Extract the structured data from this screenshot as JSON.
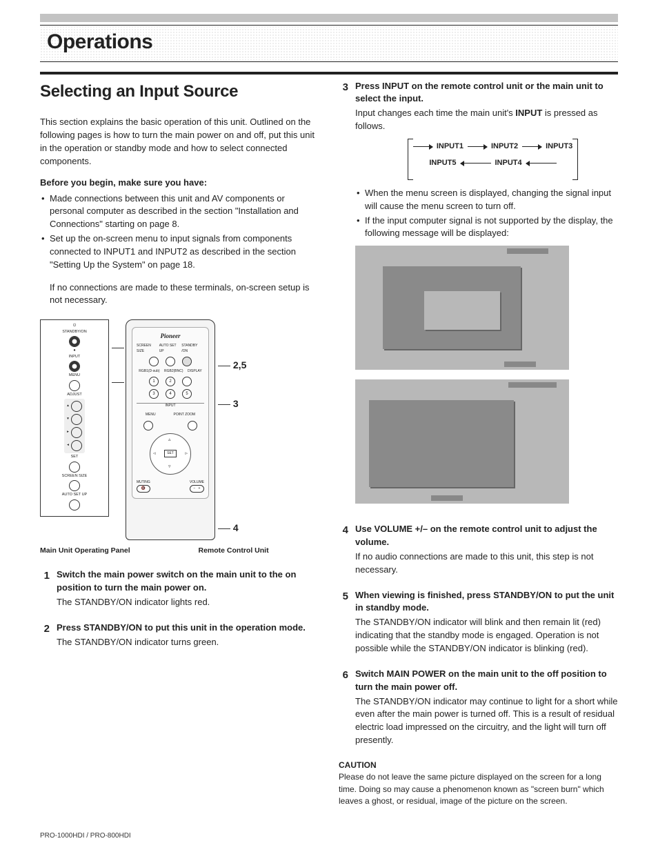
{
  "chapter": "Operations",
  "section_title": "Selecting an Input Source",
  "intro": "This section explains the basic operation of this unit. Outlined on the following pages is how to turn the main power on and off, put this unit in the operation or standby mode and how to select connected components.",
  "before_begin_heading": "Before you begin, make sure you have:",
  "before_begin_items": [
    "Made connections between this unit and AV components or personal computer as described in the section \"Installation and Connections\" starting on page 8.",
    "Set up the on-screen menu to input signals from components connected to INPUT1 and INPUT2 as described in the section \"Setting Up the System\" on page 18."
  ],
  "before_begin_note": "If no connections are made to these terminals, on-screen setup is not necessary.",
  "panel_caption": "Main Unit Operating Panel",
  "remote_caption": "Remote Control Unit",
  "panel_labels": {
    "standby": "STANDBY/ON",
    "input": "INPUT",
    "menu": "MENU",
    "adjust": "ADJUST",
    "set": "SET",
    "screen_size": "SCREEN SIZE",
    "auto_setup": "AUTO SET UP"
  },
  "remote_labels": {
    "brand": "Pioneer",
    "screen_size": "SCREEN SIZE",
    "auto_setup": "AUTO SET UP",
    "standby": "STANDBY /ON",
    "rgb1": "RGB1(D-sub)",
    "rgb2": "RGB2(BNC)",
    "display": "DISPLAY",
    "input_hdr": "INPUT",
    "menu": "MENU",
    "point_zoom": "POINT ZOOM",
    "set": "SET",
    "muting": "MUTING",
    "volume": "VOLUME"
  },
  "callouts": {
    "panel_25": "2,5",
    "panel_3": "3",
    "remote_25": "2,5",
    "remote_3": "3",
    "remote_4": "4"
  },
  "steps_left": [
    {
      "num": "1",
      "head": "Switch the main power switch on the main unit to the on position to turn the main power on.",
      "body": [
        "The STANDBY/ON indicator lights red."
      ]
    },
    {
      "num": "2",
      "head": "Press STANDBY/ON to put this unit in the operation mode.",
      "body": [
        "The STANDBY/ON indicator turns green."
      ]
    }
  ],
  "step3": {
    "num": "3",
    "head": "Press INPUT on the remote control unit or the main unit to select the input.",
    "body1": "Input changes each time the main unit's ",
    "body1_bold": "INPUT",
    "body1_tail": " is pressed as follows.",
    "cycle": {
      "i1": "INPUT1",
      "i2": "INPUT2",
      "i3": "INPUT3",
      "i4": "INPUT4",
      "i5": "INPUT5"
    },
    "bullets": [
      "When the menu screen is displayed, changing the signal input will cause the menu screen to turn off.",
      "If the input computer signal is not supported by the display, the following message will be displayed:"
    ]
  },
  "step4": {
    "num": "4",
    "head": "Use VOLUME +/– on the remote control unit to adjust the volume.",
    "body": [
      "If no audio connections are made to this unit, this step is not necessary."
    ]
  },
  "step5": {
    "num": "5",
    "head": "When viewing is finished, press STANDBY/ON to put the unit in standby mode.",
    "body": [
      "The STANDBY/ON indicator will blink and then remain lit (red) indicating that the standby mode is engaged. Operation is not possible while the STANDBY/ON indicator is blinking (red)."
    ]
  },
  "step6": {
    "num": "6",
    "head": "Switch MAIN POWER on the main unit to the off position to turn the main power off.",
    "body": [
      "The STANDBY/ON indicator may continue to light for a short while even after the main power is turned off. This is a result of residual electric load impressed on the circuitry, and the light will turn off presently."
    ]
  },
  "caution_head": "CAUTION",
  "caution_text": "Please do not leave the same picture displayed on the screen for a long time. Doing so may cause a phenomenon known as \"screen burn\" which leaves a ghost, or residual, image of the picture on the screen.",
  "footer": "PRO-1000HDI / PRO-800HDI"
}
